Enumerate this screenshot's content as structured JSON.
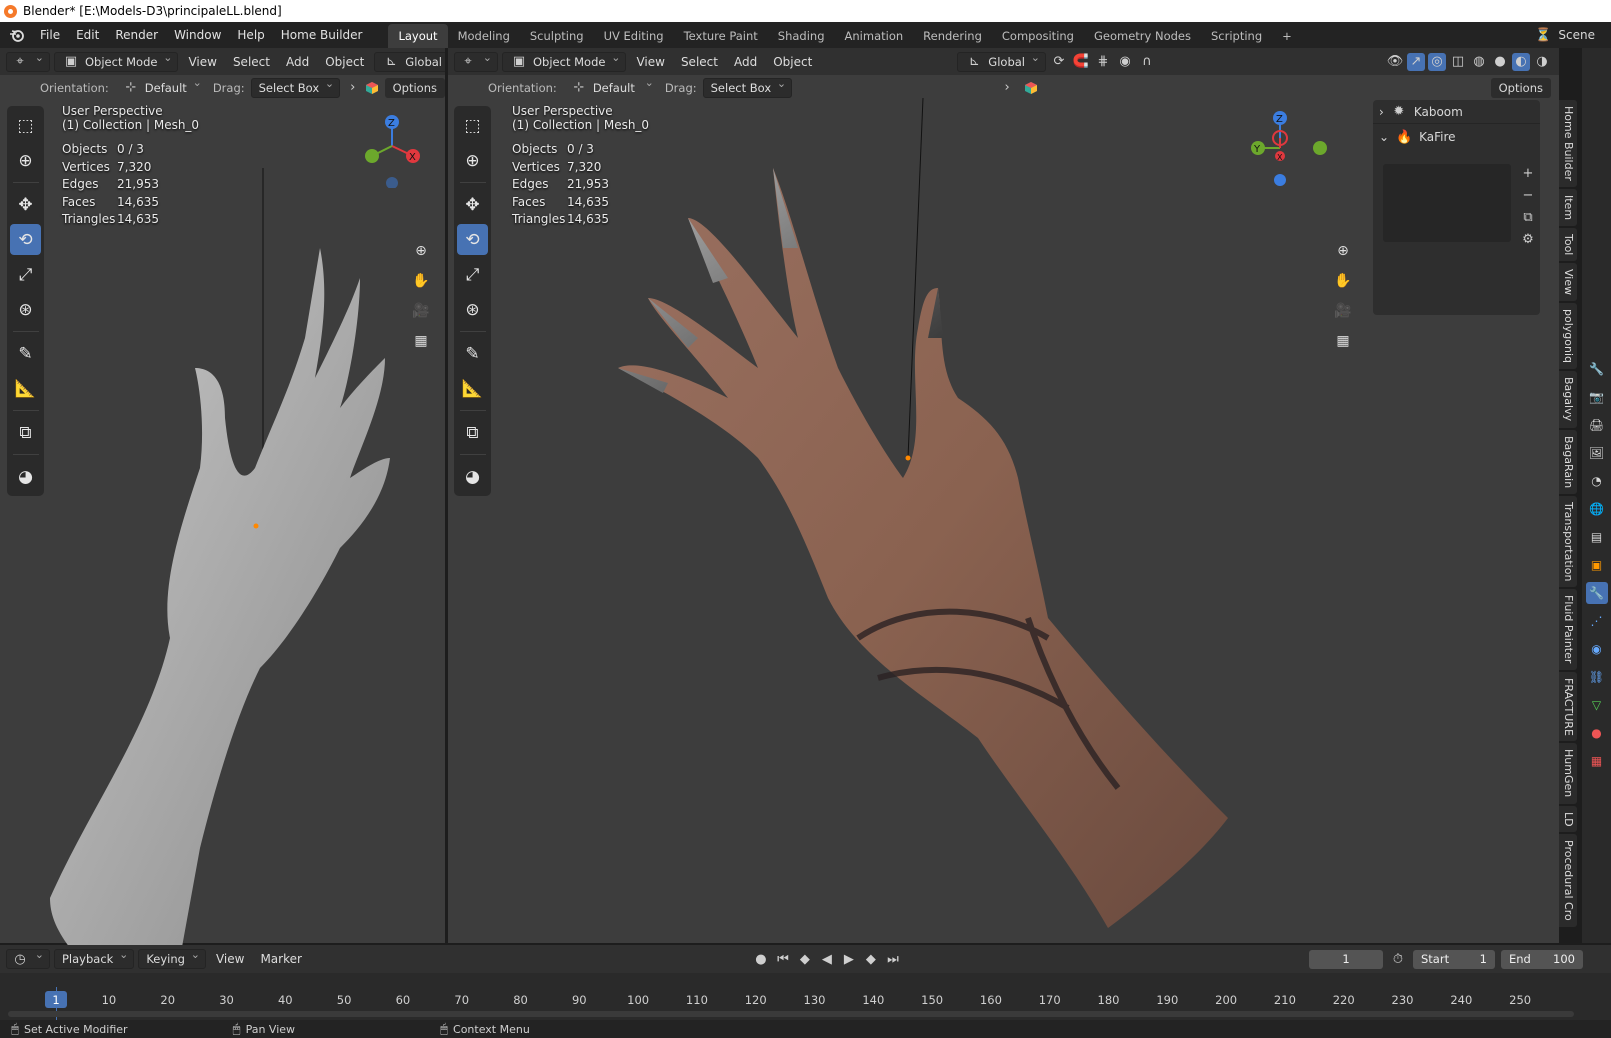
{
  "window": {
    "title": "Blender* [E:\\Models-D3\\principaleLL.blend]"
  },
  "menu": [
    "File",
    "Edit",
    "Render",
    "Window",
    "Help",
    "Home Builder"
  ],
  "workspaces": [
    {
      "label": "Layout",
      "active": true
    },
    {
      "label": "Modeling"
    },
    {
      "label": "Sculpting"
    },
    {
      "label": "UV Editing"
    },
    {
      "label": "Texture Paint"
    },
    {
      "label": "Shading"
    },
    {
      "label": "Animation"
    },
    {
      "label": "Rendering"
    },
    {
      "label": "Compositing"
    },
    {
      "label": "Geometry Nodes"
    },
    {
      "label": "Scripting"
    }
  ],
  "scene_label": "Scene",
  "left_viewport": {
    "mode": "Object Mode",
    "menus": [
      "View",
      "Select",
      "Add",
      "Object"
    ],
    "transform_orientation": "Global",
    "orientation_label": "Orientation:",
    "orientation_value": "Default",
    "drag_label": "Drag:",
    "drag_value": "Select Box",
    "options": "Options",
    "overlay_title": "User Perspective",
    "overlay_subtitle": "(1) Collection | Mesh_0",
    "stats": [
      {
        "k": "Objects",
        "v": "0 / 3"
      },
      {
        "k": "Vertices",
        "v": "7,320"
      },
      {
        "k": "Edges",
        "v": "21,953"
      },
      {
        "k": "Faces",
        "v": "14,635"
      },
      {
        "k": "Triangles",
        "v": "14,635"
      }
    ]
  },
  "right_viewport": {
    "mode": "Object Mode",
    "menus": [
      "View",
      "Select",
      "Add",
      "Object"
    ],
    "transform_orientation": "Global",
    "orientation_label": "Orientation:",
    "orientation_value": "Default",
    "drag_label": "Drag:",
    "drag_value": "Select Box",
    "options": "Options",
    "overlay_title": "User Perspective",
    "overlay_subtitle": "(1) Collection | Mesh_0",
    "stats": [
      {
        "k": "Objects",
        "v": "0 / 3"
      },
      {
        "k": "Vertices",
        "v": "7,320"
      },
      {
        "k": "Edges",
        "v": "21,953"
      },
      {
        "k": "Faces",
        "v": "14,635"
      },
      {
        "k": "Triangles",
        "v": "14,635"
      }
    ]
  },
  "gizmo": {
    "z": "Z",
    "y": "Y",
    "x": "X"
  },
  "npanel": {
    "items": [
      {
        "label": "Kaboom",
        "expanded": false
      },
      {
        "label": "KaFire",
        "expanded": true
      }
    ]
  },
  "side_tabs": [
    "Home Builder",
    "Item",
    "Tool",
    "View",
    "polygoniq",
    "Bagalvy",
    "BagaRain",
    "Transportation",
    "Fluid Painter",
    "FRACTURE",
    "HumGen",
    "LD",
    "Procedural Cro"
  ],
  "timeline": {
    "menus": [
      "Playback",
      "Keying",
      "View",
      "Marker"
    ],
    "current_frame": "1",
    "start_label": "Start",
    "start": "1",
    "end_label": "End",
    "end": "100",
    "ticks": [
      "1",
      "10",
      "20",
      "30",
      "40",
      "50",
      "60",
      "70",
      "80",
      "90",
      "100",
      "110",
      "120",
      "130",
      "140",
      "150",
      "160",
      "170",
      "180",
      "190",
      "200",
      "210",
      "220",
      "230",
      "240",
      "250"
    ]
  },
  "status": {
    "items": [
      "Set Active Modifier",
      "Pan View",
      "Context Menu"
    ]
  }
}
